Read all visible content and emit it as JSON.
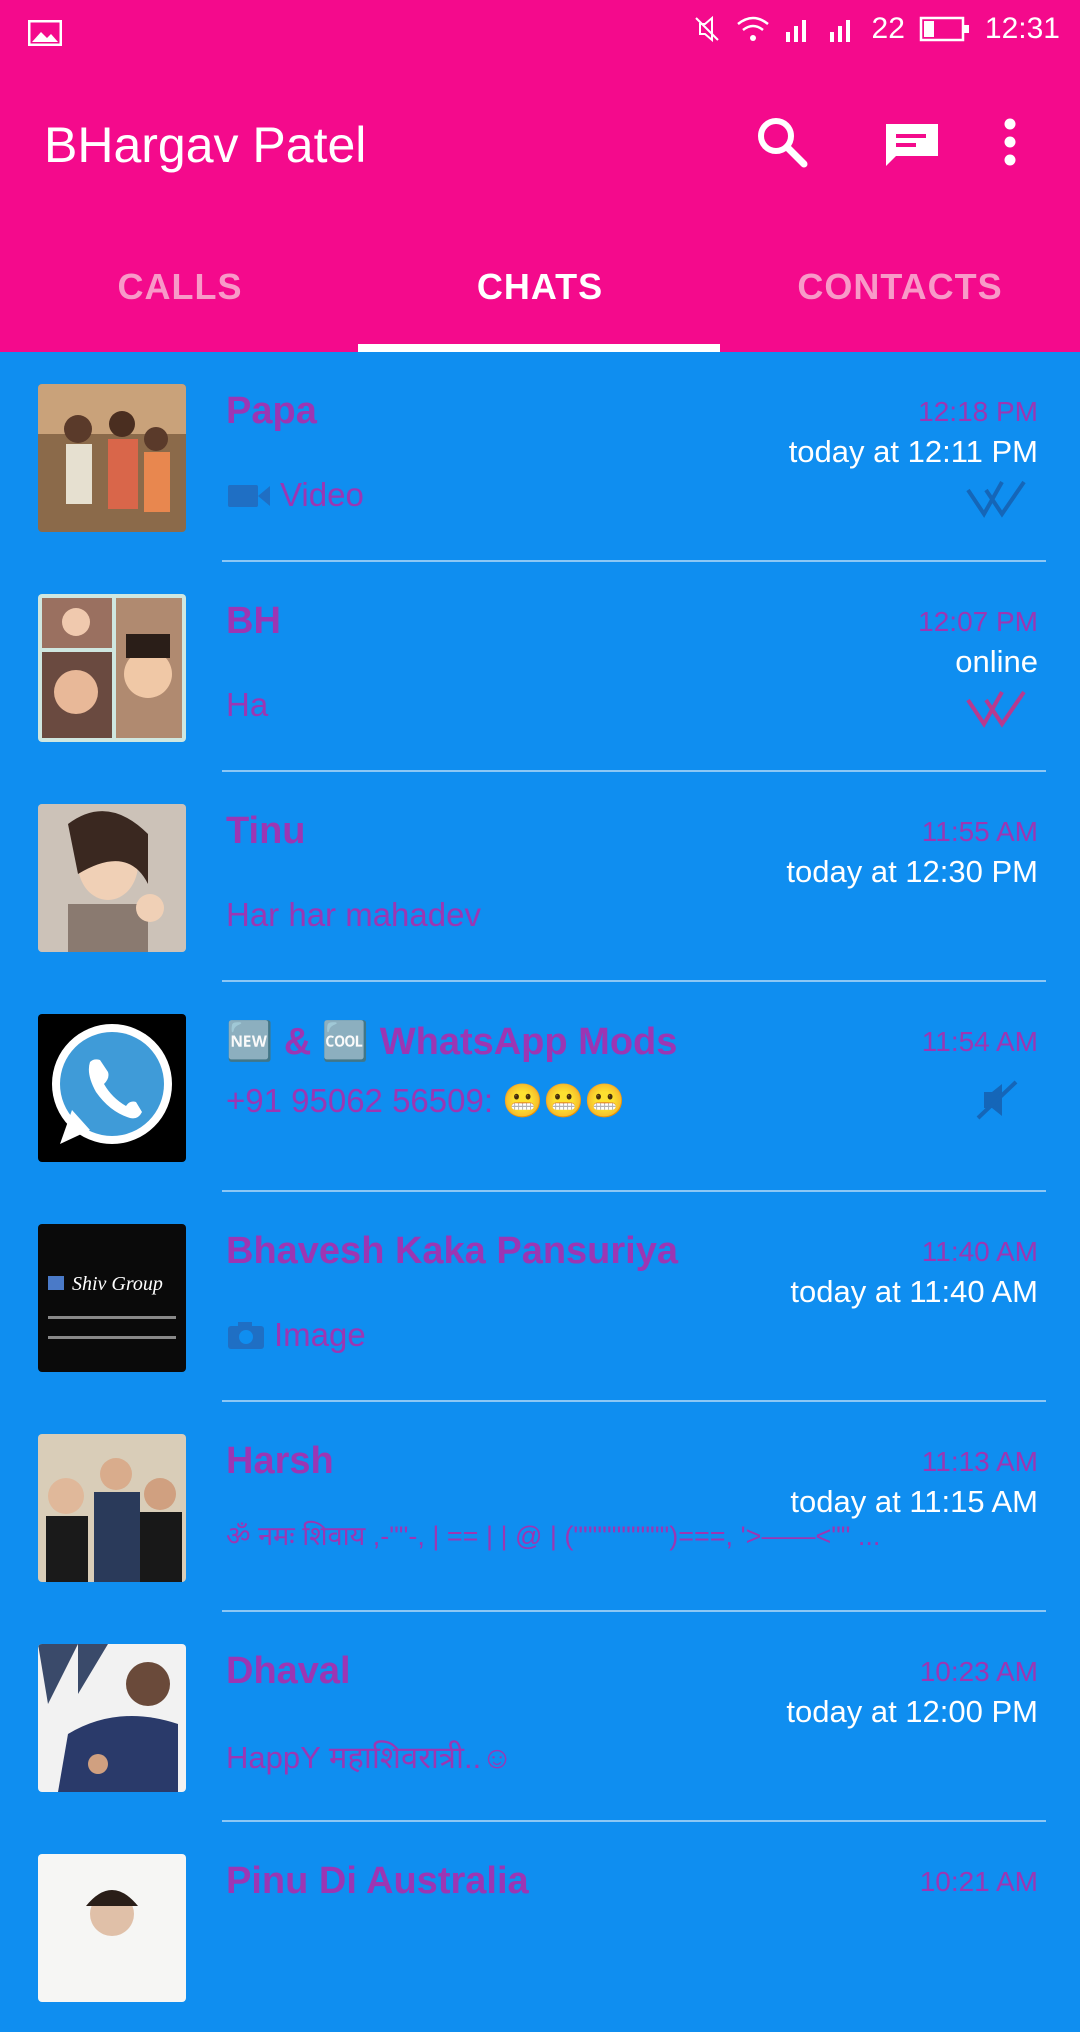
{
  "status_bar": {
    "signal_label": "22",
    "time": "12:31"
  },
  "app_bar": {
    "title": "BHargav Patel"
  },
  "tabs": [
    {
      "label": "CALLS",
      "selected": false
    },
    {
      "label": "CHATS",
      "selected": true
    },
    {
      "label": "CONTACTS",
      "selected": false
    }
  ],
  "chats": [
    {
      "name": "Papa",
      "time": "12:18 PM",
      "last_seen": "today at 12:11 PM",
      "preview": "Video",
      "preview_icon": "video-icon",
      "status_icon": "double-tick-icon",
      "status_color": "#1566b8"
    },
    {
      "name": "BH",
      "time": "12:07 PM",
      "last_seen": "online",
      "preview": "Ha",
      "preview_icon": "",
      "status_icon": "double-tick-icon",
      "status_color": "#b73a8f"
    },
    {
      "name": "Tinu",
      "time": "11:55 AM",
      "last_seen": "today at 12:30 PM",
      "preview": "Har har mahadev",
      "preview_icon": "",
      "status_icon": "",
      "status_color": ""
    },
    {
      "name": "🆕 & 🆒 WhatsApp Mods",
      "time": "11:54 AM",
      "last_seen": "",
      "preview": "+91 95062 56509: 😬😬😬",
      "preview_icon": "",
      "status_icon": "muted-icon",
      "status_color": "#1566b8"
    },
    {
      "name": "Bhavesh Kaka Pansuriya",
      "time": "11:40 AM",
      "last_seen": "today at 11:40 AM",
      "preview": "Image",
      "preview_icon": "camera-icon",
      "status_icon": "",
      "status_color": ""
    },
    {
      "name": "Harsh",
      "time": "11:13 AM",
      "last_seen": "today at 11:15 AM",
      "preview": "ॐ नमः शिवाय ,-\"\"-, | == | | @ | (\"\"\"\"\"\"\"\"\"\")===, '>——<\"\" ...",
      "preview_icon": "",
      "status_icon": "",
      "status_color": ""
    },
    {
      "name": "Dhaval",
      "time": "10:23 AM",
      "last_seen": "today at 12:00 PM",
      "preview": "HappY महाशिवरात्री..☺",
      "preview_icon": "",
      "status_icon": "",
      "status_color": ""
    },
    {
      "name": "Pinu Di Australia",
      "time": "10:21 AM",
      "last_seen": "",
      "preview": "",
      "preview_icon": "",
      "status_icon": "",
      "status_color": ""
    }
  ],
  "colors": {
    "appbar": "#f40a8c",
    "list_bg": "#0f8ef0",
    "name_text": "#9c36b3",
    "tab_inactive": "#f89ac8"
  }
}
